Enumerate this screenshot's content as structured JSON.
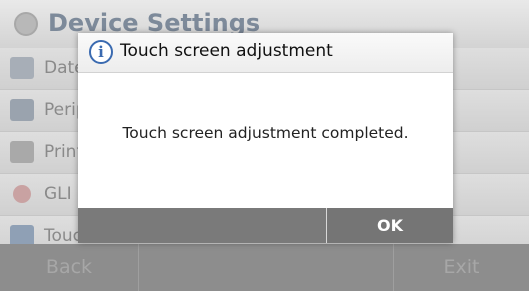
{
  "background": {
    "title": "Device Settings",
    "items": [
      {
        "label": "Date",
        "icon": "calendar-icon"
      },
      {
        "label": "Peripheral",
        "icon": "usb-icon"
      },
      {
        "label": "Printer",
        "icon": "printer-icon"
      },
      {
        "label": "GLI",
        "icon": "gli-icon"
      },
      {
        "label": "Touch",
        "icon": "touch-screen-icon"
      }
    ],
    "footer": {
      "back_label": "Back",
      "exit_label": "Exit"
    }
  },
  "dialog": {
    "title": "Touch screen adjustment",
    "icon": "info-icon",
    "message": "Touch screen adjustment completed.",
    "ok_label": "OK"
  },
  "colors": {
    "dialog_footer": "#777777",
    "info_icon": "#3a6ab0",
    "overlay": "#9a9a9a"
  }
}
